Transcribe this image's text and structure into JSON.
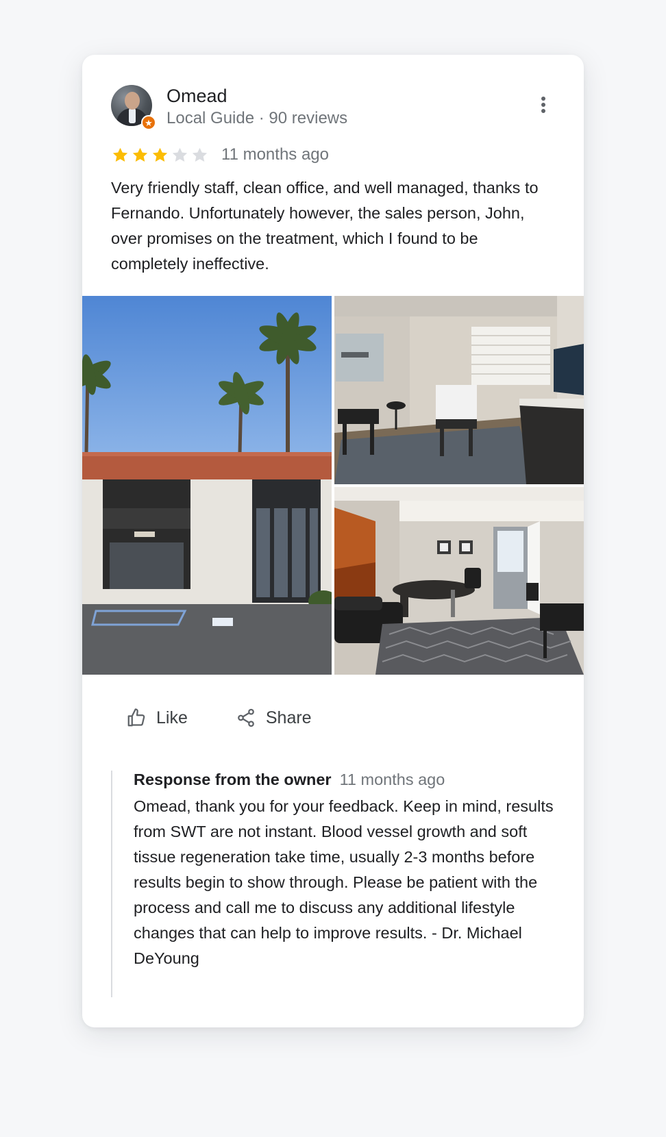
{
  "review": {
    "reviewer_name": "Omead",
    "reviewer_meta": "Local Guide · 90 reviews",
    "rating": 3,
    "rating_max": 5,
    "time_ago": "11 months ago",
    "text": "Very friendly staff, clean office, and well managed, thanks to Fernando. Unfortunately however, the sales person, John, over promises on the treatment, which I found to be completely ineffective.",
    "badge_icon": "local-guide-star-icon",
    "menu_icon": "more-vert-icon"
  },
  "photos": [
    {
      "subject": "building exterior with palm trees"
    },
    {
      "subject": "treatment room"
    },
    {
      "subject": "office with desk"
    }
  ],
  "actions": {
    "like_label": "Like",
    "like_icon": "thumb-up-icon",
    "share_label": "Share",
    "share_icon": "share-icon"
  },
  "owner_response": {
    "title": "Response from the owner",
    "time_ago": "11 months ago",
    "text": "Omead, thank you for your feedback. Keep in mind, results from SWT are not instant. Blood vessel growth and soft tissue regeneration take time, usually 2-3 months before results begin to show through. Please be patient with the process and call me to discuss any additional lifestyle changes that can help to improve results. - Dr. Michael DeYoung"
  },
  "colors": {
    "star_filled": "#fbbc04",
    "star_empty": "#dadce0",
    "badge": "#e8710a",
    "text_primary": "#202124",
    "text_secondary": "#70757a"
  }
}
